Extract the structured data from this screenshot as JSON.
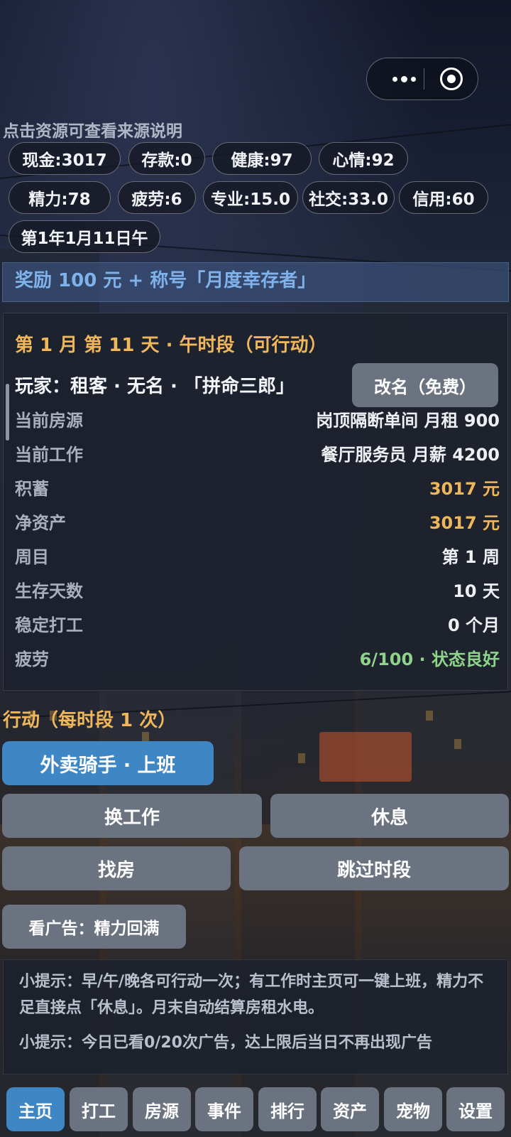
{
  "hint": "点击资源可查看来源说明",
  "stats": [
    "现金:3017",
    "存款:0",
    "健康:97",
    "心情:92",
    "精力:78",
    "疲劳:6",
    "专业:15.0",
    "社交:33.0",
    "信用:60",
    "第1年1月11日午"
  ],
  "banner": "奖励 100 元 + 称号「月度幸存者」",
  "status": {
    "title": "第 1 月 第 11 天 · 午时段（可行动）",
    "player": "玩家：租客 · 无名 · 「拼命三郎」",
    "rename_button": "改名（免费）",
    "rows": [
      {
        "label": "当前房源",
        "value": "岗顶隔断单间 月租 900"
      },
      {
        "label": "当前工作",
        "value": "餐厅服务员 月薪 4200"
      },
      {
        "label": "积蓄",
        "value": "3017 元"
      },
      {
        "label": "净资产",
        "value": "3017 元"
      },
      {
        "label": "周目",
        "value": "第 1 周"
      },
      {
        "label": "生存天数",
        "value": "10 天"
      },
      {
        "label": "稳定打工",
        "value": "0 个月"
      },
      {
        "label": "疲劳",
        "value": "6/100 · 状态良好"
      }
    ]
  },
  "actions": {
    "title": "行动（每时段 1 次）",
    "primary": "外卖骑手 · 上班",
    "change_job": "换工作",
    "rest": "休息",
    "find_house": "找房",
    "skip": "跳过时段",
    "watch_ad": "看广告：精力回满"
  },
  "tips": [
    "小提示：早/午/晚各可行动一次；有工作时主页可一键上班，精力不足直接点「休息」。月末自动结算房租水电。",
    "小提示：今日已看0/20次广告，达上限后当日不再出现广告"
  ],
  "tabs": [
    "主页",
    "打工",
    "房源",
    "事件",
    "排行",
    "资产",
    "宠物",
    "设置"
  ],
  "active_tab": "主页",
  "colors": {
    "accent_orange": "#f0b65a",
    "accent_blue": "#3f86c4",
    "good_green": "#8ed38a",
    "button_gray": "#6b7380"
  }
}
